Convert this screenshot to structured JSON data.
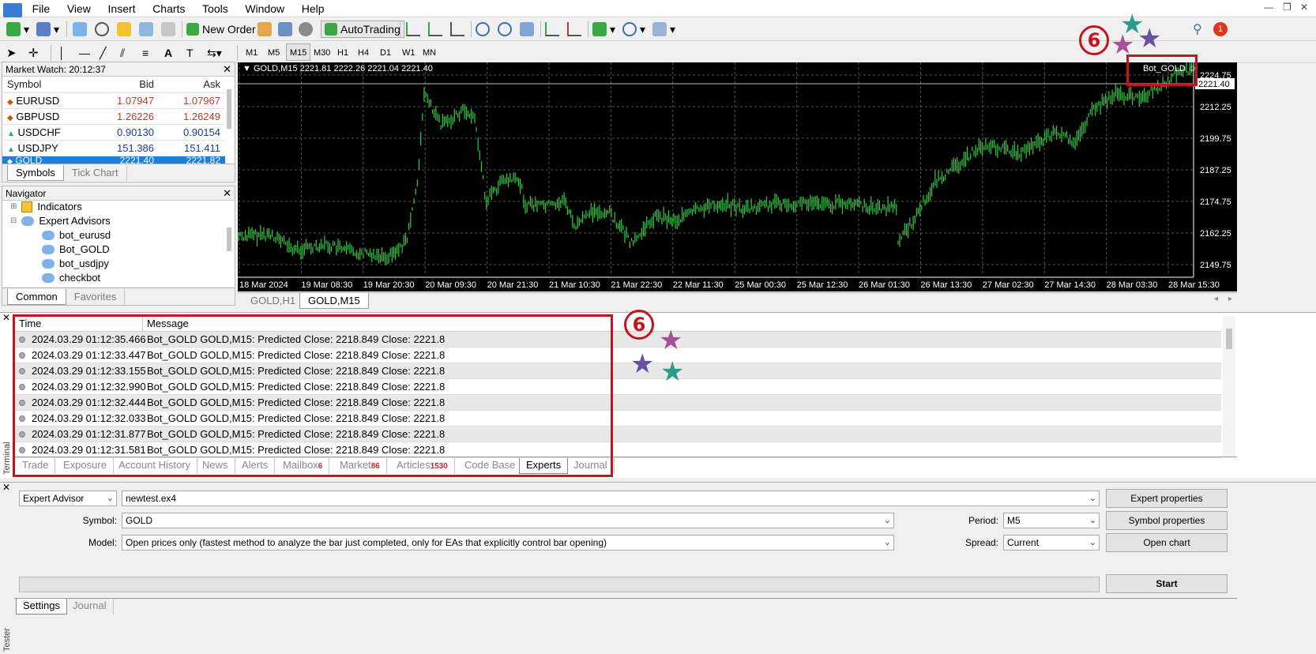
{
  "menu": [
    "File",
    "View",
    "Insert",
    "Charts",
    "Tools",
    "Window",
    "Help"
  ],
  "toolbar": {
    "new_order": "New Order",
    "autotrading": "AutoTrading",
    "timeframes": [
      "M1",
      "M5",
      "M15",
      "M30",
      "H1",
      "H4",
      "D1",
      "W1",
      "MN"
    ],
    "active_tf": "M15",
    "notifications": "1"
  },
  "market_watch": {
    "title": "Market Watch: 20:12:37",
    "columns": [
      "Symbol",
      "Bid",
      "Ask"
    ],
    "rows": [
      {
        "symbol": "EURUSD",
        "bid": "1.07947",
        "ask": "1.07967",
        "color": "#c0392b"
      },
      {
        "symbol": "GBPUSD",
        "bid": "1.26226",
        "ask": "1.26249",
        "color": "#c0392b"
      },
      {
        "symbol": "USDCHF",
        "bid": "0.90130",
        "ask": "0.90154",
        "color": "#1b3a9c"
      },
      {
        "symbol": "USDJPY",
        "bid": "151.386",
        "ask": "151.411",
        "color": "#1b3a9c"
      },
      {
        "symbol": "GOLD",
        "bid": "2221.40",
        "ask": "2221.82",
        "color": "#ffffff"
      }
    ],
    "tabs": [
      "Symbols",
      "Tick Chart"
    ]
  },
  "navigator": {
    "title": "Navigator",
    "items": [
      "Indicators",
      "Expert Advisors",
      "bot_eurusd",
      "Bot_GOLD",
      "bot_usdjpy",
      "checkbot"
    ],
    "tabs": [
      "Common",
      "Favorites"
    ]
  },
  "chart": {
    "header": "GOLD,M15  2221.81 2222.26 2221.04 2221.40",
    "ea_label": "Bot_GOLD ☺",
    "current_price": "2221.40",
    "price_labels": [
      "2224.75",
      "2212.25",
      "2199.75",
      "2187.25",
      "2174.75",
      "2162.25",
      "2149.75"
    ],
    "time_labels": [
      "18 Mar 2024",
      "19 Mar 08:30",
      "19 Mar 20:30",
      "20 Mar 09:30",
      "20 Mar 21:30",
      "21 Mar 10:30",
      "21 Mar 22:30",
      "22 Mar 11:30",
      "25 Mar 00:30",
      "25 Mar 12:30",
      "26 Mar 01:30",
      "26 Mar 13:30",
      "27 Mar 02:30",
      "27 Mar 14:30",
      "28 Mar 03:30",
      "28 Mar 15:30"
    ],
    "tabs": [
      "GOLD,H1",
      "GOLD,M15"
    ],
    "series_color": "#2ecc40"
  },
  "terminal": {
    "label": "Terminal",
    "columns": [
      "Time",
      "Message"
    ],
    "rows": [
      {
        "time": "2024.03.29 01:12:35.466",
        "msg": "Bot_GOLD GOLD,M15: Predicted Close: 2218.849 Close: 2221.8"
      },
      {
        "time": "2024.03.29 01:12:33.447",
        "msg": "Bot_GOLD GOLD,M15: Predicted Close: 2218.849 Close: 2221.8"
      },
      {
        "time": "2024.03.29 01:12:33.155",
        "msg": "Bot_GOLD GOLD,M15: Predicted Close: 2218.849 Close: 2221.8"
      },
      {
        "time": "2024.03.29 01:12:32.990",
        "msg": "Bot_GOLD GOLD,M15: Predicted Close: 2218.849 Close: 2221.8"
      },
      {
        "time": "2024.03.29 01:12:32.444",
        "msg": "Bot_GOLD GOLD,M15: Predicted Close: 2218.849 Close: 2221.8"
      },
      {
        "time": "2024.03.29 01:12:32.033",
        "msg": "Bot_GOLD GOLD,M15: Predicted Close: 2218.849 Close: 2221.8"
      },
      {
        "time": "2024.03.29 01:12:31.877",
        "msg": "Bot_GOLD GOLD,M15: Predicted Close: 2218.849 Close: 2221.8"
      },
      {
        "time": "2024.03.29 01:12:31.581",
        "msg": "Bot_GOLD GOLD,M15: Predicted Close: 2218.849 Close: 2221.8"
      }
    ],
    "tabs": [
      {
        "label": "Trade",
        "count": ""
      },
      {
        "label": "Exposure",
        "count": ""
      },
      {
        "label": "Account History",
        "count": ""
      },
      {
        "label": "News",
        "count": ""
      },
      {
        "label": "Alerts",
        "count": ""
      },
      {
        "label": "Mailbox",
        "count": "6"
      },
      {
        "label": "Market",
        "count": "86"
      },
      {
        "label": "Articles",
        "count": "1530"
      },
      {
        "label": "Code Base",
        "count": ""
      },
      {
        "label": "Experts",
        "count": ""
      },
      {
        "label": "Journal",
        "count": ""
      }
    ],
    "active_tab": "Experts"
  },
  "annotation": {
    "number": "6",
    "color": "#c4141c"
  },
  "tester": {
    "label": "Tester",
    "type": "Expert Advisor",
    "file": "newtest.ex4",
    "symbol_label": "Symbol:",
    "symbol": "GOLD",
    "model_label": "Model:",
    "model": "Open prices only (fastest method to analyze the bar just completed, only for EAs that explicitly control bar opening)",
    "period_label": "Period:",
    "period": "M5",
    "spread_label": "Spread:",
    "spread": "Current",
    "buttons": {
      "expert_props": "Expert properties",
      "symbol_props": "Symbol properties",
      "open_chart": "Open chart",
      "start": "Start"
    },
    "tabs": [
      "Settings",
      "Journal"
    ]
  }
}
